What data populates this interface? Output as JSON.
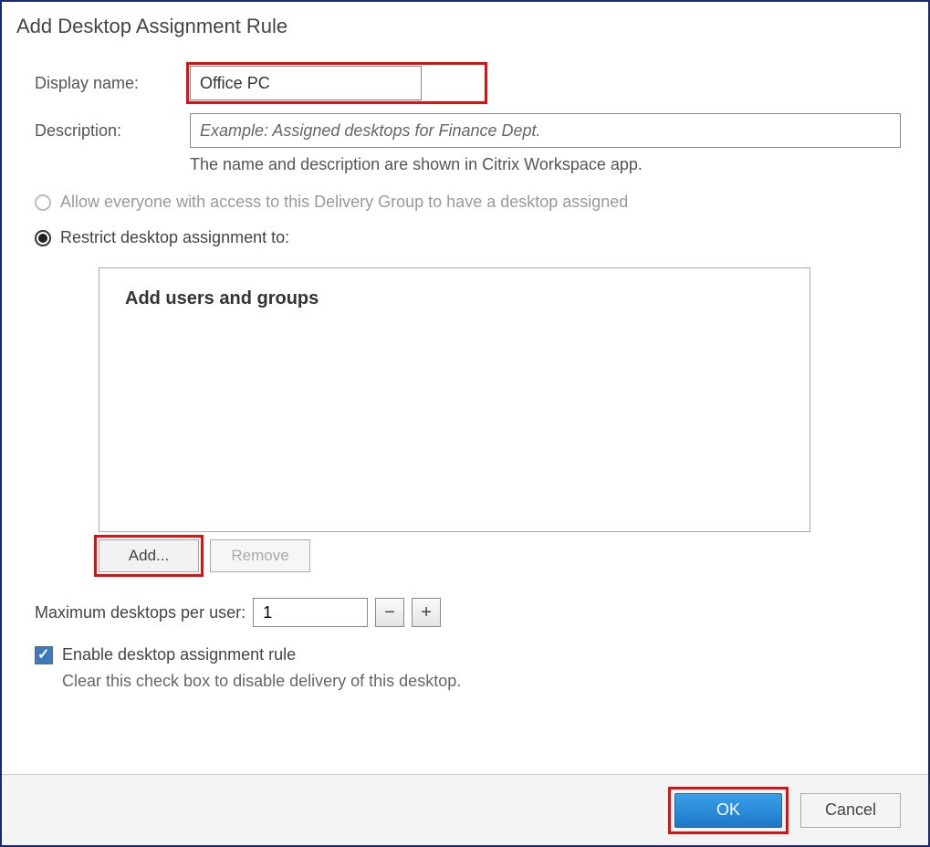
{
  "dialog": {
    "title": "Add Desktop Assignment Rule"
  },
  "form": {
    "displayName": {
      "label": "Display name:",
      "value": "Office PC"
    },
    "description": {
      "label": "Description:",
      "placeholder": "Example: Assigned desktops for Finance Dept."
    },
    "helper": "The name and description are shown in Citrix Workspace app."
  },
  "radios": {
    "allowEveryone": "Allow everyone with access to this Delivery Group to have a desktop assigned",
    "restrict": "Restrict desktop assignment to:"
  },
  "usersPanel": {
    "title": "Add users and groups",
    "addButton": "Add...",
    "removeButton": "Remove"
  },
  "maxDesktops": {
    "label": "Maximum desktops per user:",
    "value": "1",
    "minus": "−",
    "plus": "+"
  },
  "enableRule": {
    "label": "Enable desktop assignment rule",
    "help": "Clear this check box to disable delivery of this desktop."
  },
  "footer": {
    "ok": "OK",
    "cancel": "Cancel"
  }
}
